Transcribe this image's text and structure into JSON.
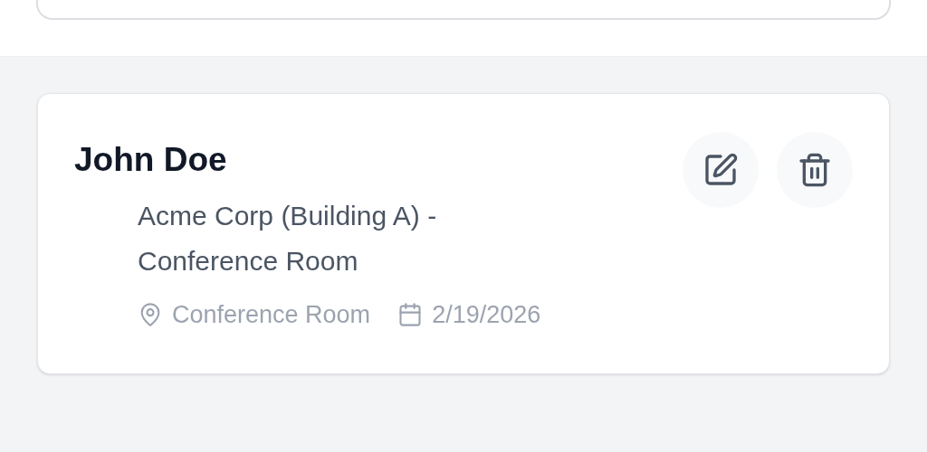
{
  "entry": {
    "name": "John Doe",
    "description": "Acme Corp (Building A) - Conference Room",
    "location": "Conference Room",
    "date": "2/19/2026"
  }
}
